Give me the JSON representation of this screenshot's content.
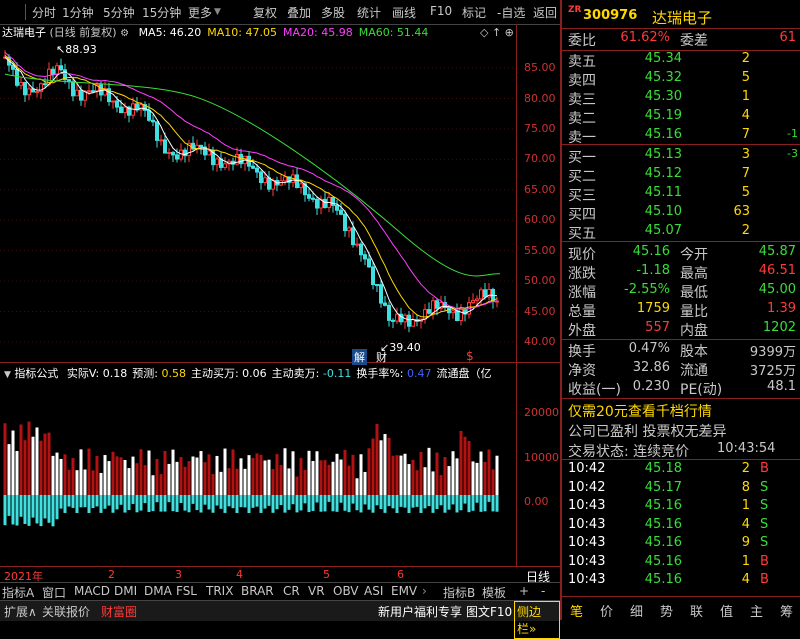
{
  "toolbar": {
    "items": [
      "分时",
      "1分钟",
      "5分钟",
      "15分钟",
      "更多",
      "复权",
      "叠加",
      "多股",
      "统计",
      "画线",
      "F10",
      "标记",
      "-自选",
      "返回"
    ]
  },
  "chart": {
    "name": "达瑞电子",
    "period": "(日线 前复权)",
    "ma": [
      {
        "label": "MA5: 46.20",
        "color": "#ffffff"
      },
      {
        "label": "MA10: 47.05",
        "color": "#ffd800"
      },
      {
        "label": "MA20: 45.98",
        "color": "#ff40ff"
      },
      {
        "label": "MA60: 51.44",
        "color": "#3adc3a"
      }
    ],
    "high_marker": "88.93",
    "low_marker": "39.40",
    "jie_label": "解",
    "cai_label": "财",
    "dollar_label": "$",
    "price_axis": [
      "85.00",
      "80.00",
      "75.00",
      "70.00",
      "65.00",
      "60.00",
      "55.00",
      "50.00",
      "45.00",
      "40.00"
    ],
    "vol_axis": [
      "20000",
      "10000",
      "0.00"
    ]
  },
  "indicator": {
    "name": "指标公式",
    "items": [
      {
        "label": "实际V: ",
        "value": "0.18",
        "color": "#ffffff"
      },
      {
        "label": "预测: ",
        "value": "0.58",
        "color": "#ffd800"
      },
      {
        "label": "主动买万: ",
        "value": "0.06",
        "color": "#ffffff"
      },
      {
        "label": "主动卖万: ",
        "value": "-0.11",
        "color": "#40e0e0"
      },
      {
        "label": "换手率%: ",
        "value": "0.47",
        "color": "#4060ff"
      },
      {
        "label": "流通盘（亿",
        "value": "",
        "color": "#ffffff"
      }
    ]
  },
  "dates": [
    "2021年",
    "2",
    "3",
    "4",
    "5",
    "6"
  ],
  "period_label": "日线",
  "tabs": [
    "指标A",
    "窗口",
    "MACD",
    "DMI",
    "DMA",
    "FSL",
    "TRIX",
    "BRAR",
    "CR",
    "VR",
    "OBV",
    "ASI",
    "EMV",
    "指标B",
    "模板",
    "+",
    "-"
  ],
  "status_bar": {
    "left": [
      "扩展∧",
      "关联报价",
      "财富圈"
    ],
    "right": [
      "新用户福利专享",
      "图文F10",
      "侧边栏"
    ]
  },
  "quote": {
    "tag": "ZR",
    "code": "300976",
    "name": "达瑞电子",
    "weibi_label": "委比",
    "weibi_value": "61.62%",
    "weicha_label": "委差",
    "weicha_value": "61",
    "asks": [
      {
        "label": "卖五",
        "price": "45.34",
        "vol": "2",
        "chg": ""
      },
      {
        "label": "卖四",
        "price": "45.32",
        "vol": "5",
        "chg": ""
      },
      {
        "label": "卖三",
        "price": "45.30",
        "vol": "1",
        "chg": ""
      },
      {
        "label": "卖二",
        "price": "45.19",
        "vol": "4",
        "chg": ""
      },
      {
        "label": "卖一",
        "price": "45.16",
        "vol": "7",
        "chg": "-1"
      }
    ],
    "bids": [
      {
        "label": "买一",
        "price": "45.13",
        "vol": "3",
        "chg": "-3"
      },
      {
        "label": "买二",
        "price": "45.12",
        "vol": "7",
        "chg": ""
      },
      {
        "label": "买三",
        "price": "45.11",
        "vol": "5",
        "chg": ""
      },
      {
        "label": "买四",
        "price": "45.10",
        "vol": "63",
        "chg": ""
      },
      {
        "label": "买五",
        "price": "45.07",
        "vol": "2",
        "chg": ""
      }
    ],
    "stats": [
      {
        "l1": "现价",
        "v1": "45.16",
        "c1": "green",
        "l2": "今开",
        "v2": "45.87",
        "c2": "green"
      },
      {
        "l1": "涨跌",
        "v1": "-1.18",
        "c1": "green",
        "l2": "最高",
        "v2": "46.51",
        "c2": "red"
      },
      {
        "l1": "涨幅",
        "v1": "-2.55%",
        "c1": "green",
        "l2": "最低",
        "v2": "45.00",
        "c2": "green"
      },
      {
        "l1": "总量",
        "v1": "1759",
        "c1": "yellow",
        "l2": "量比",
        "v2": "1.39",
        "c2": "red"
      },
      {
        "l1": "外盘",
        "v1": "557",
        "c1": "red",
        "l2": "内盘",
        "v2": "1202",
        "c2": "green"
      }
    ],
    "stats2": [
      {
        "l1": "换手",
        "v1": "0.47%",
        "l2": "股本",
        "v2": "9399万"
      },
      {
        "l1": "净资",
        "v1": "32.86",
        "l2": "流通",
        "v2": "3725万"
      },
      {
        "l1": "收益(一)",
        "v1": "0.230",
        "l2": "PE(动)",
        "v2": "48.1"
      }
    ],
    "promo": "仅需20元查看千档行情",
    "notice": "公司已盈利 投票权无差异",
    "trade_status_label": "交易状态: 连续竞价",
    "trade_time": "10:43:54",
    "ticks": [
      {
        "time": "10:42",
        "price": "45.18",
        "vol": "2",
        "dir": "B"
      },
      {
        "time": "10:42",
        "price": "45.17",
        "vol": "8",
        "dir": "S"
      },
      {
        "time": "10:43",
        "price": "45.16",
        "vol": "1",
        "dir": "S"
      },
      {
        "time": "10:43",
        "price": "45.16",
        "vol": "4",
        "dir": "S"
      },
      {
        "time": "10:43",
        "price": "45.16",
        "vol": "9",
        "dir": "S"
      },
      {
        "time": "10:43",
        "price": "45.16",
        "vol": "1",
        "dir": "B"
      },
      {
        "time": "10:43",
        "price": "45.16",
        "vol": "4",
        "dir": "B"
      }
    ],
    "bottom_tabs": [
      "笔",
      "价",
      "细",
      "势",
      "联",
      "值",
      "主",
      "筹"
    ]
  }
}
